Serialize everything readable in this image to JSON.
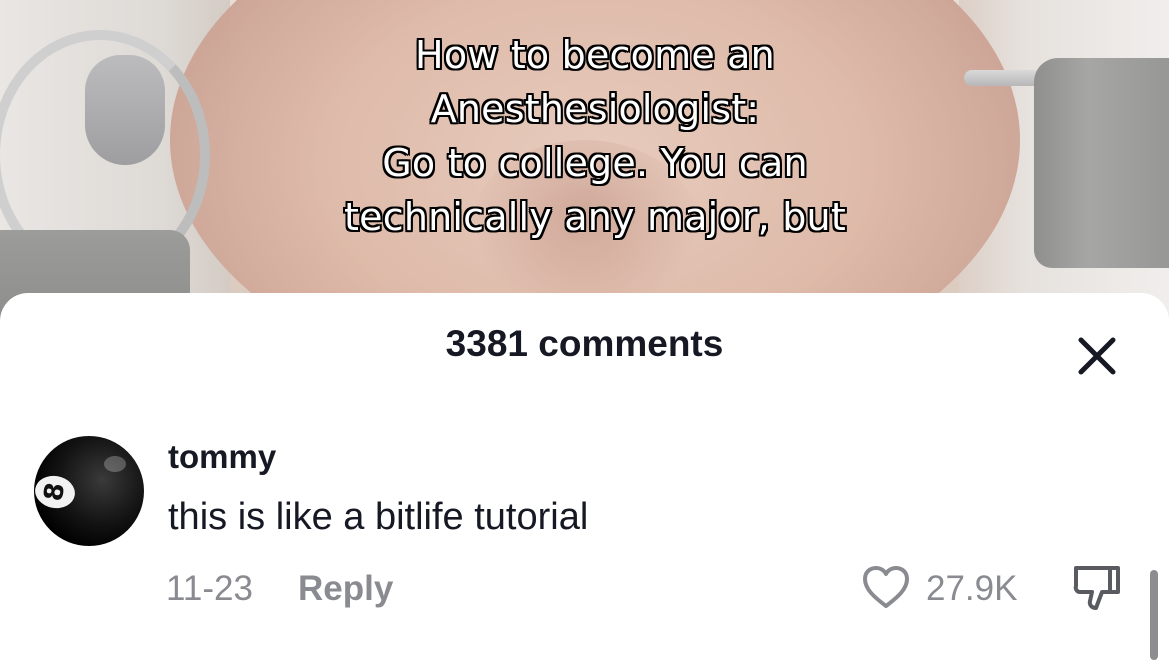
{
  "video": {
    "caption_lines": [
      "How to become an",
      "Anesthesiologist:",
      "Go to college. You can",
      "technically any major, but"
    ]
  },
  "comments_panel": {
    "title": "3381 comments",
    "close_icon": "close-icon"
  },
  "comment": {
    "username": "tommy",
    "text": "this is like a bitlife tutorial",
    "date": "11-23",
    "reply_label": "Reply",
    "like_count": "27.9K",
    "avatar_badge": "8",
    "like_icon": "heart-icon",
    "dislike_icon": "thumbs-down-icon"
  },
  "colors": {
    "text_primary": "#161823",
    "text_secondary": "#8a8b91",
    "sheet_background": "#ffffff"
  }
}
